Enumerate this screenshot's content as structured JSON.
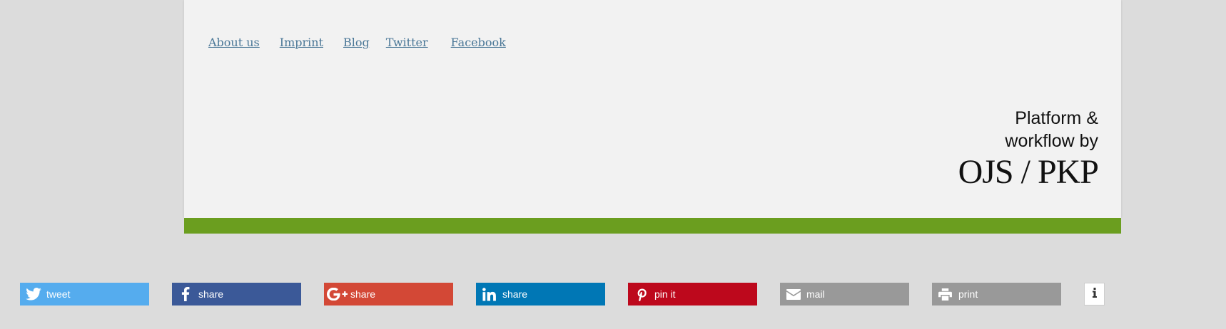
{
  "footer": {
    "links": [
      {
        "label": "About us"
      },
      {
        "label": "Imprint"
      },
      {
        "label": "Blog"
      },
      {
        "label": "Twitter"
      },
      {
        "label": "Facebook"
      }
    ],
    "brand": {
      "line1": "Platform &",
      "line2": "workflow by",
      "logo": "OJS / PKP"
    },
    "accent_color": "#6b9e1f",
    "link_color": "#4a7797"
  },
  "share_buttons": [
    {
      "label": "tweet",
      "icon": "twitter-bird-icon",
      "color": "#55acee"
    },
    {
      "label": "share",
      "icon": "facebook-f-icon",
      "color": "#3b5998"
    },
    {
      "label": "share",
      "icon": "google-plus-icon",
      "color": "#d34836"
    },
    {
      "label": "share",
      "icon": "linkedin-in-icon",
      "color": "#0077b5"
    },
    {
      "label": "pin it",
      "icon": "pinterest-p-icon",
      "color": "#bd081c"
    },
    {
      "label": "mail",
      "icon": "envelope-icon",
      "color": "#999999"
    },
    {
      "label": "print",
      "icon": "printer-icon",
      "color": "#999999"
    }
  ],
  "info_button": {
    "icon": "info-icon"
  }
}
